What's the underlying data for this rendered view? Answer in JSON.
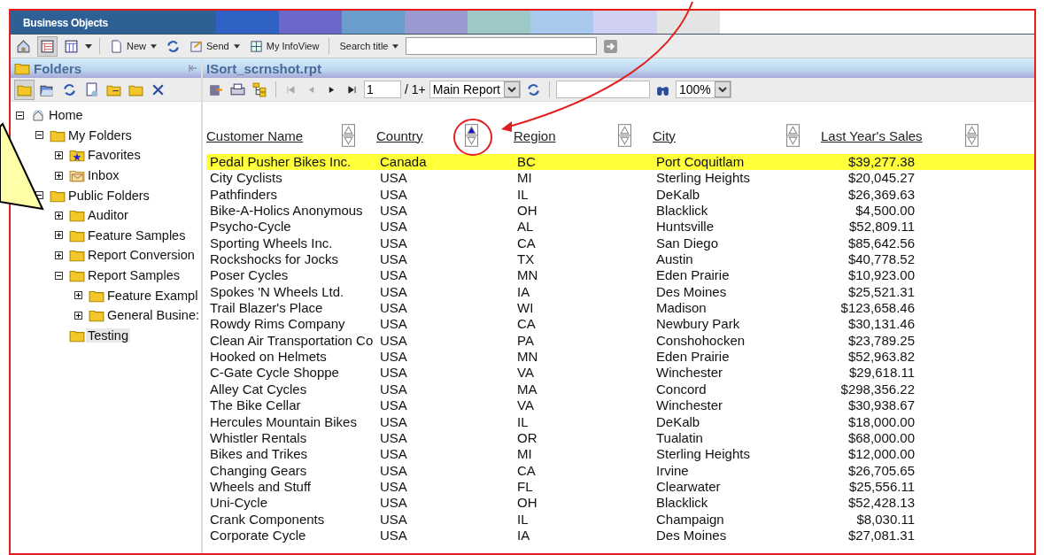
{
  "banner": {
    "logo": "Business Objects"
  },
  "toolbar": {
    "new_label": "New",
    "send_label": "Send",
    "infoview_label": "My InfoView",
    "search_label": "Search title"
  },
  "folders_panel": {
    "title": "Folders",
    "tree": [
      {
        "label": "Home",
        "kind": "home",
        "expanded": true,
        "selected": false,
        "children": [
          {
            "label": "My Folders",
            "kind": "folder",
            "expanded": true,
            "selected": false,
            "children": [
              {
                "label": "Favorites",
                "kind": "favorites",
                "expanded": false,
                "selected": false
              },
              {
                "label": "Inbox",
                "kind": "inbox",
                "expanded": false,
                "selected": false
              }
            ]
          },
          {
            "label": "Public Folders",
            "kind": "folder",
            "expanded": true,
            "selected": false,
            "children": [
              {
                "label": "Auditor",
                "kind": "folder",
                "expanded": false,
                "selected": false
              },
              {
                "label": "Feature Samples",
                "kind": "folder",
                "expanded": false,
                "selected": false
              },
              {
                "label": "Report Conversion",
                "kind": "folder",
                "expanded": false,
                "selected": false
              },
              {
                "label": "Report Samples",
                "kind": "folder",
                "expanded": true,
                "selected": false,
                "children": [
                  {
                    "label": "Feature Exampl",
                    "kind": "folder",
                    "expanded": false,
                    "selected": false
                  },
                  {
                    "label": "General Busine:",
                    "kind": "folder",
                    "expanded": false,
                    "selected": false
                  }
                ]
              },
              {
                "label": "Testing",
                "kind": "leaf",
                "selected": true
              }
            ]
          }
        ]
      }
    ]
  },
  "report": {
    "title": "ISort_scrnshot.rpt",
    "page": "1",
    "page_total": "/ 1+",
    "view": "Main Report",
    "zoom": "100%",
    "columns": [
      {
        "label": "Customer Name",
        "sorted_ascending": false
      },
      {
        "label": "Country",
        "sorted_ascending": true
      },
      {
        "label": "Region",
        "sorted_ascending": false
      },
      {
        "label": "City",
        "sorted_ascending": false
      },
      {
        "label": "Last Year's Sales",
        "sorted_ascending": false
      }
    ],
    "rows": [
      {
        "cells": [
          "Pedal Pusher Bikes Inc.",
          "Canada",
          "BC",
          "Port Coquitlam",
          "$39,277.38"
        ],
        "highlighted": true
      },
      {
        "cells": [
          "City Cyclists",
          "USA",
          "MI",
          "Sterling Heights",
          "$20,045.27"
        ],
        "highlighted": false
      },
      {
        "cells": [
          "Pathfinders",
          "USA",
          "IL",
          "DeKalb",
          "$26,369.63"
        ],
        "highlighted": false
      },
      {
        "cells": [
          "Bike-A-Holics Anonymous",
          "USA",
          "OH",
          "Blacklick",
          "$4,500.00"
        ],
        "highlighted": false
      },
      {
        "cells": [
          "Psycho-Cycle",
          "USA",
          "AL",
          "Huntsville",
          "$52,809.11"
        ],
        "highlighted": false
      },
      {
        "cells": [
          "Sporting Wheels Inc.",
          "USA",
          "CA",
          "San Diego",
          "$85,642.56"
        ],
        "highlighted": false
      },
      {
        "cells": [
          "Rockshocks for Jocks",
          "USA",
          "TX",
          "Austin",
          "$40,778.52"
        ],
        "highlighted": false
      },
      {
        "cells": [
          "Poser Cycles",
          "USA",
          "MN",
          "Eden Prairie",
          "$10,923.00"
        ],
        "highlighted": false
      },
      {
        "cells": [
          "Spokes 'N Wheels Ltd.",
          "USA",
          "IA",
          "Des Moines",
          "$25,521.31"
        ],
        "highlighted": false
      },
      {
        "cells": [
          "Trail Blazer's Place",
          "USA",
          "WI",
          "Madison",
          "$123,658.46"
        ],
        "highlighted": false
      },
      {
        "cells": [
          "Rowdy Rims Company",
          "USA",
          "CA",
          "Newbury Park",
          "$30,131.46"
        ],
        "highlighted": false
      },
      {
        "cells": [
          "Clean Air Transportation Co",
          "USA",
          "PA",
          "Conshohocken",
          "$23,789.25"
        ],
        "highlighted": false
      },
      {
        "cells": [
          "Hooked on Helmets",
          "USA",
          "MN",
          "Eden Prairie",
          "$52,963.82"
        ],
        "highlighted": false
      },
      {
        "cells": [
          "C-Gate Cycle Shoppe",
          "USA",
          "VA",
          "Winchester",
          "$29,618.11"
        ],
        "highlighted": false
      },
      {
        "cells": [
          "Alley Cat Cycles",
          "USA",
          "MA",
          "Concord",
          "$298,356.22"
        ],
        "highlighted": false
      },
      {
        "cells": [
          "The Bike Cellar",
          "USA",
          "VA",
          "Winchester",
          "$30,938.67"
        ],
        "highlighted": false
      },
      {
        "cells": [
          "Hercules Mountain Bikes",
          "USA",
          "IL",
          "DeKalb",
          "$18,000.00"
        ],
        "highlighted": false
      },
      {
        "cells": [
          "Whistler Rentals",
          "USA",
          "OR",
          "Tualatin",
          "$68,000.00"
        ],
        "highlighted": false
      },
      {
        "cells": [
          "Bikes and Trikes",
          "USA",
          "MI",
          "Sterling Heights",
          "$12,000.00"
        ],
        "highlighted": false
      },
      {
        "cells": [
          "Changing Gears",
          "USA",
          "CA",
          "Irvine",
          "$26,705.65"
        ],
        "highlighted": false
      },
      {
        "cells": [
          "Wheels and Stuff",
          "USA",
          "FL",
          "Clearwater",
          "$25,556.11"
        ],
        "highlighted": false
      },
      {
        "cells": [
          "Uni-Cycle",
          "USA",
          "OH",
          "Blacklick",
          "$52,428.13"
        ],
        "highlighted": false
      },
      {
        "cells": [
          "Crank Components",
          "USA",
          "IL",
          "Champaign",
          "$8,030.11"
        ],
        "highlighted": false
      },
      {
        "cells": [
          "Corporate Cycle",
          "USA",
          "IA",
          "Des Moines",
          "$27,081.31"
        ],
        "highlighted": false
      }
    ]
  }
}
